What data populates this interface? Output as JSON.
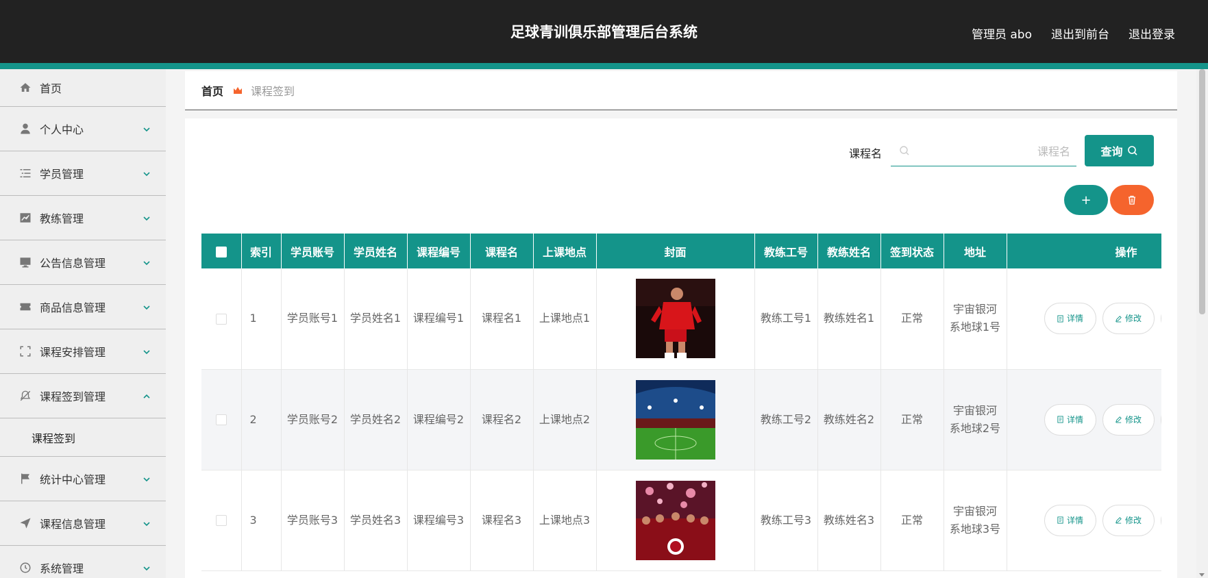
{
  "header": {
    "title": "足球青训俱乐部管理后台系统",
    "admin_label": "管理员 abo",
    "to_front_label": "退出到前台",
    "logout_label": "退出登录",
    "accent": "#14948a"
  },
  "sidebar": {
    "items": [
      {
        "label": "首页",
        "icon": "home-icon"
      },
      {
        "label": "个人中心",
        "icon": "user-icon"
      },
      {
        "label": "学员管理",
        "icon": "list-icon"
      },
      {
        "label": "教练管理",
        "icon": "chart-icon"
      },
      {
        "label": "公告信息管理",
        "icon": "monitor-icon"
      },
      {
        "label": "商品信息管理",
        "icon": "ticket-icon"
      },
      {
        "label": "课程安排管理",
        "icon": "fullscreen-icon"
      },
      {
        "label": "课程签到管理",
        "icon": "bell-off-icon"
      },
      {
        "label": "统计中心管理",
        "icon": "flag-icon"
      },
      {
        "label": "课程信息管理",
        "icon": "send-icon"
      },
      {
        "label": "系统管理",
        "icon": "clock-icon"
      }
    ],
    "sub_items": [
      {
        "label": "课程签到"
      }
    ]
  },
  "breadcrumb": {
    "home": "首页",
    "current": "课程签到"
  },
  "search": {
    "label": "课程名",
    "placeholder": "课程名",
    "query_label": "查询"
  },
  "toolbar": {
    "add_label": "+",
    "add_color": "#14948a",
    "delete_color": "#f5642d"
  },
  "table": {
    "headers": [
      "索引",
      "学员账号",
      "学员姓名",
      "课程编号",
      "课程名",
      "上课地点",
      "封面",
      "教练工号",
      "教练姓名",
      "签到状态",
      "地址",
      "操作"
    ],
    "rows": [
      {
        "index": "1",
        "account": "学员账号1",
        "name": "学员姓名1",
        "course_no": "课程编号1",
        "course": "课程名1",
        "place": "上课地点1",
        "coach_no": "教练工号1",
        "coach_name": "教练姓名1",
        "status": "正常",
        "address": "宇宙银河系地球1号"
      },
      {
        "index": "2",
        "account": "学员账号2",
        "name": "学员姓名2",
        "course_no": "课程编号2",
        "course": "课程名2",
        "place": "上课地点2",
        "coach_no": "教练工号2",
        "coach_name": "教练姓名2",
        "status": "正常",
        "address": "宇宙银河系地球2号"
      },
      {
        "index": "3",
        "account": "学员账号3",
        "name": "学员姓名3",
        "course_no": "课程编号3",
        "course": "课程名3",
        "place": "上课地点3",
        "coach_no": "教练工号3",
        "coach_name": "教练姓名3",
        "status": "正常",
        "address": "宇宙银河系地球3号"
      }
    ],
    "detail_label": "详情",
    "edit_label": "修改"
  }
}
